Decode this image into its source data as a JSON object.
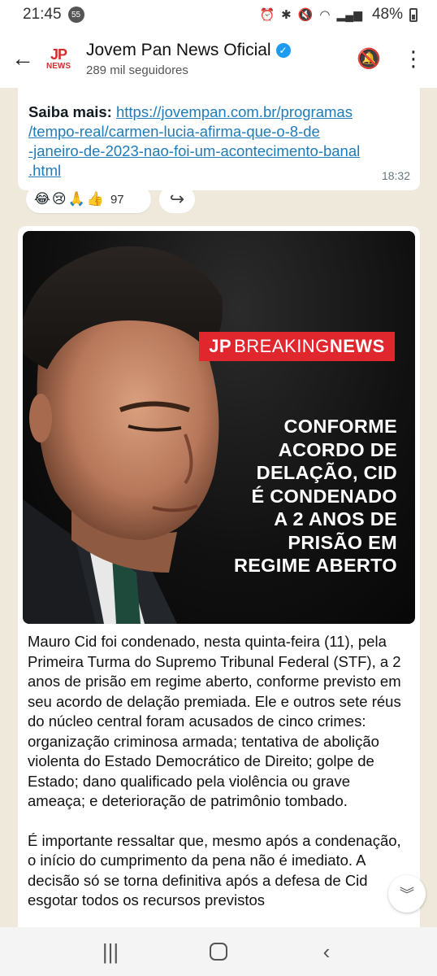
{
  "status_bar": {
    "time": "21:45",
    "notification_count": "55",
    "battery": "48%",
    "icons": [
      "alarm-icon",
      "bluetooth-icon",
      "mute-icon",
      "wifi-icon",
      "signal-icon",
      "battery-icon"
    ]
  },
  "header": {
    "channel_name": "Jovem Pan News Oficial",
    "followers": "289 mil seguidores",
    "logo_top": "JP",
    "logo_bottom": "NEWS",
    "verified_icon": "verified-badge-icon",
    "mute_icon": "notifications-off-icon",
    "menu_icon": "more-vert-icon"
  },
  "previous_message": {
    "label": "Saiba mais:",
    "link": "https://jovempan.com.br/programas/tempo-real/carmen-lucia-afirma-que-o-8-de-janeiro-de-2023-nao-foi-um-acontecimento-banal.html",
    "link_lines": [
      "https://jovempan.com.br/programas",
      "/tempo-real/carmen-lucia-afirma-que-o-8-de",
      "-janeiro-de-2023-nao-foi-um-acontecimento-banal",
      ".html"
    ],
    "time": "18:32",
    "reactions": [
      "😂",
      "😢",
      "🙏",
      "👍"
    ],
    "reaction_count": "97"
  },
  "news_post": {
    "image": {
      "badge_jp": "JP",
      "badge_breaking": "BREAKING",
      "badge_news": "NEWS",
      "headline_lines": [
        "CONFORME",
        "ACORDO DE",
        "DELAÇÃO, CID",
        "É CONDENADO",
        "A 2 ANOS DE",
        "PRISÃO EM",
        "REGIME ABERTO"
      ]
    },
    "paragraphs": [
      "Mauro Cid foi condenado, nesta quinta-feira (11), pela Primeira Turma do Supremo Tribunal Federal (STF), a 2 anos de prisão em regime aberto, conforme previsto em seu acordo de delação premiada. Ele e outros sete réus do núcleo central foram acusados de cinco crimes: organização criminosa armada; tentativa de abolição violenta do Estado Democrático de Direito; golpe de Estado; dano qualificado pela violência ou grave ameaça; e deterioração de patrimônio tombado.",
      "É importante ressaltar que, mesmo após a condenação, o início do cumprimento da pena não é imediato. A decisão só se torna definitiva após a defesa de Cid esgotar todos os recursos previstos"
    ]
  },
  "nav_bar": {
    "recents_icon": "recents-icon",
    "home_icon": "home-icon",
    "back_icon": "back-icon"
  },
  "colors": {
    "link": "#1e7bb8",
    "brand_red": "#e0272d",
    "chat_background": "#efe9dc"
  }
}
